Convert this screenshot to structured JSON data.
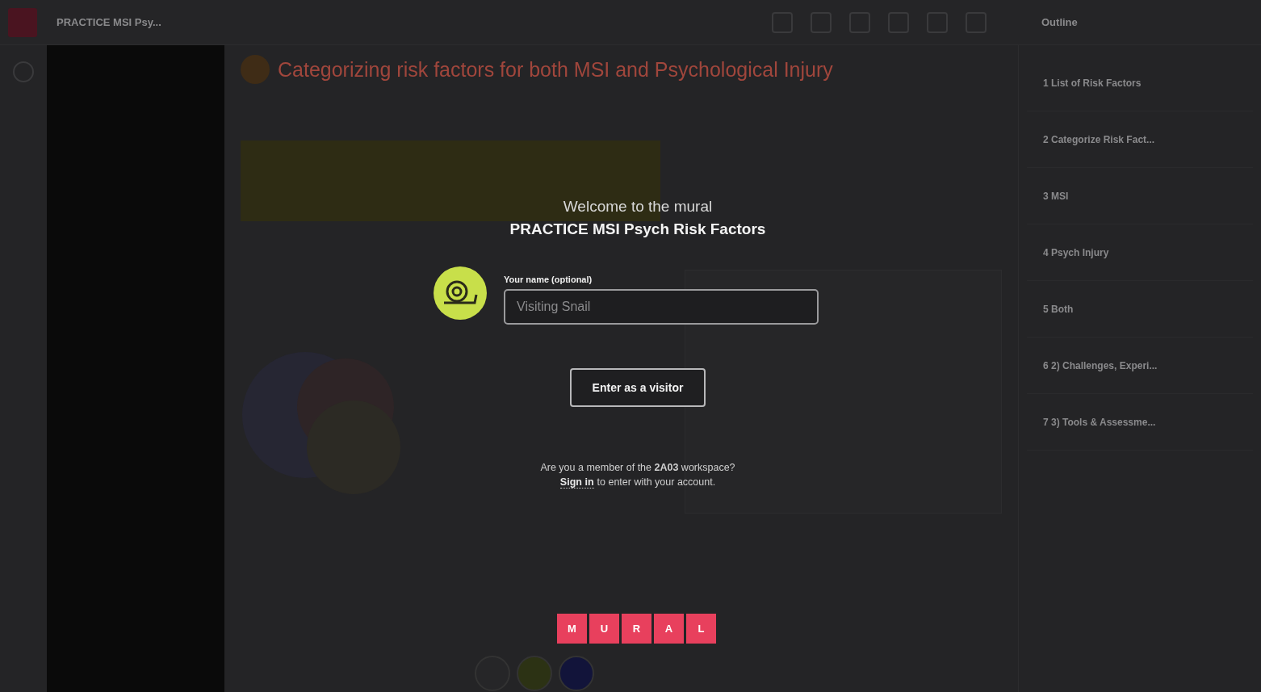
{
  "topbar": {
    "mural_title": "PRACTICE MSI Psy..."
  },
  "canvas": {
    "heading": "Categorizing risk factors for both MSI and Psychological Injury"
  },
  "outline": {
    "title": "Outline",
    "items": [
      {
        "label": "1 List of Risk Factors",
        "selected": false
      },
      {
        "label": "2 Categorize Risk Fact...",
        "selected": false
      },
      {
        "label": "3 MSI",
        "selected": false
      },
      {
        "label": "4 Psych Injury",
        "selected": false
      },
      {
        "label": "5 Both",
        "selected": false
      },
      {
        "label": "6 2) Challenges, Experi...",
        "selected": false
      },
      {
        "label": "7 3) Tools & Assessme...",
        "selected": false
      }
    ]
  },
  "welcome_dialog": {
    "greeting": "Welcome to the mural",
    "mural_name": "PRACTICE MSI Psych Risk Factors",
    "name_field": {
      "label": "Your name (optional)",
      "placeholder": "Visiting Snail"
    },
    "enter_button": "Enter as a visitor",
    "member_question": "Are you a member of the **2A03** workspace?",
    "sign_in_link": "Sign in",
    "sign_in_rest": "to enter with your account.",
    "logo_letters": [
      "M",
      "U",
      "R",
      "A",
      "L"
    ]
  }
}
